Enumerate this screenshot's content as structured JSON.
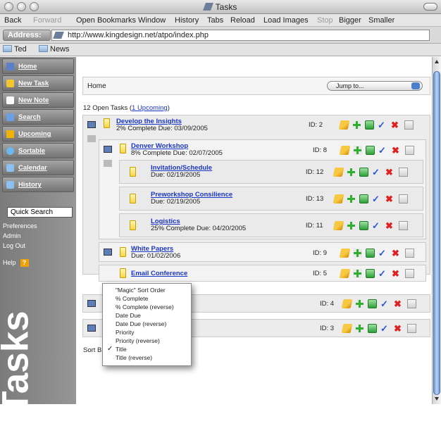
{
  "window": {
    "title": "Tasks"
  },
  "menu": {
    "items": [
      "Back",
      "Forward",
      "Open Bookmarks Window",
      "History",
      "Tabs",
      "Reload",
      "Load Images",
      "Stop",
      "Bigger",
      "Smaller"
    ],
    "disabled": [
      "Forward",
      "Stop"
    ]
  },
  "address": {
    "label": "Address:",
    "url": "http://www.kingdesign.net/atpo/index.php"
  },
  "bookmarks": [
    "Ted",
    "News"
  ],
  "sidebar": {
    "nav": [
      {
        "label": "Home",
        "icon": "home-icon",
        "color": "#5b7fc8"
      },
      {
        "label": "New Task",
        "icon": "new-task-icon",
        "color": "#f3c62d"
      },
      {
        "label": "New Note",
        "icon": "new-note-icon",
        "color": "#ffffff"
      },
      {
        "label": "Search",
        "icon": "search-icon",
        "color": "#6a9fe3"
      },
      {
        "label": "Upcoming",
        "icon": "warning-icon",
        "color": "#f0b400"
      },
      {
        "label": "Sortable",
        "icon": "sortable-icon",
        "color": "#6bb7f0"
      },
      {
        "label": "Calendar",
        "icon": "calendar-icon",
        "color": "#8cc0f0"
      },
      {
        "label": "History",
        "icon": "history-icon",
        "color": "#8cc0f0"
      }
    ],
    "quick_search_placeholder": "Quick Search",
    "links": [
      "Preferences",
      "Admin",
      "Log Out"
    ],
    "help": "Help",
    "help_icon": "?",
    "big_label": "Tasks"
  },
  "breadcrumb": {
    "text": "Home",
    "jump_label": "Jump to..."
  },
  "summary": {
    "prefix": "12 Open Tasks (",
    "link": "1 Upcoming",
    "suffix": ")"
  },
  "tasks": [
    {
      "title": "Develop the Insights",
      "sub": "2% Complete  Due: 03/09/2005",
      "id": "ID: 2"
    },
    {
      "title": "Denver Workshop",
      "sub": "8% Complete  Due: 02/07/2005",
      "id": "ID: 8"
    },
    {
      "title": "Invitation/Schedule",
      "sub": "Due: 02/19/2005",
      "id": "ID: 12"
    },
    {
      "title": "Preworkshop Consilience",
      "sub": "Due: 02/19/2005",
      "id": "ID: 13"
    },
    {
      "title": "Logistics",
      "sub": "25% Complete  Due: 04/20/2005",
      "id": "ID: 11"
    },
    {
      "title": "White Papers",
      "sub": "Due: 01/02/2006",
      "id": "ID: 9"
    },
    {
      "title": "Email Conference",
      "sub": "",
      "id": "ID: 5"
    },
    {
      "title": "",
      "sub": "",
      "id": "ID: 4"
    },
    {
      "title": "",
      "sub": "",
      "id": "ID: 3"
    }
  ],
  "sort": {
    "label": "Sort B",
    "check": "✓"
  },
  "sort_menu": [
    "\"Magic\" Sort Order",
    "% Complete",
    "% Complete (reverse)",
    "Date Due",
    "Date Due (reverse)",
    "Priority",
    "Priority (reverse)",
    "Title",
    "Title (reverse)"
  ]
}
